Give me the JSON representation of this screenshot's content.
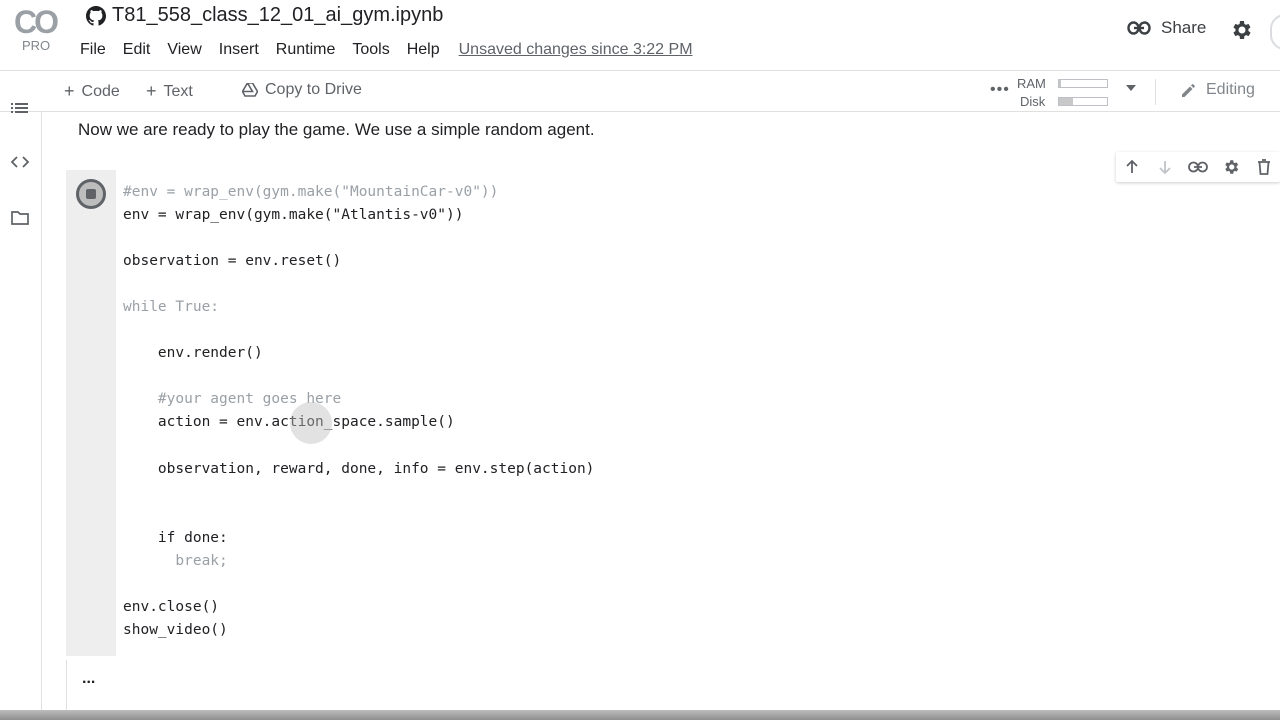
{
  "header": {
    "logo_text": "CO",
    "logo_badge": "PRO",
    "notebook_title": "T81_558_class_12_01_ai_gym.ipynb",
    "menu": [
      "File",
      "Edit",
      "View",
      "Insert",
      "Runtime",
      "Tools",
      "Help"
    ],
    "unsaved_text": "Unsaved changes since 3:22 PM",
    "share_label": "Share"
  },
  "toolbar": {
    "code_label": "Code",
    "text_label": "Text",
    "copy_drive_label": "Copy to Drive",
    "ram_label": "RAM",
    "disk_label": "Disk",
    "ram_usage": 0.05,
    "disk_usage": 0.3,
    "editing_label": "Editing"
  },
  "cells": {
    "text_cell": "Now we are ready to play the game. We use a simple random agent.",
    "code_lines": [
      "#env = wrap_env(gym.make(\"MountainCar-v0\"))",
      "env = wrap_env(gym.make(\"Atlantis-v0\"))",
      "observation = env.reset()",
      "while True:",
      "    env.render()",
      "    #your agent goes here",
      "    action = env.action_space.sample()",
      "    observation, reward, done, info = env.step(action)",
      "    if done:",
      "      break;",
      "env.close()",
      "show_video()"
    ],
    "output_ellipsis": "..."
  },
  "colors": {
    "accent_gray": "#5f6368",
    "comment": "#9aa0a6",
    "gutter_bg": "#eeeeee"
  }
}
